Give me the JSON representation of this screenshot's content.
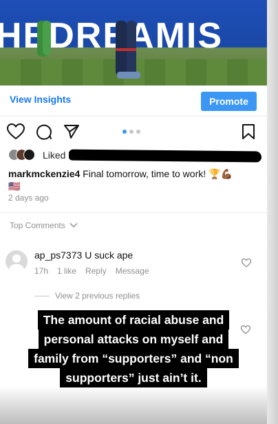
{
  "photo": {
    "board_text": "HEDREAMIS"
  },
  "actions": {
    "view_insights": "View Insights",
    "promote": "Promote"
  },
  "icons": [
    "heart-icon",
    "comment-icon",
    "send-icon",
    "bookmark-icon"
  ],
  "carousel": {
    "total": 3,
    "active": 1
  },
  "likes": {
    "prefix": "Liked b"
  },
  "caption": {
    "username": "markmckenzie4",
    "text": " Final tomorrow, time to work! 🏆💪🏾",
    "flag": "🇺🇸"
  },
  "time_ago": "2 days ago",
  "top_comments_label": "Top Comments",
  "comment": {
    "username": "ap_ps7373",
    "text": "U suck ape",
    "age": "17h",
    "likes": "1 like",
    "reply": "Reply",
    "message": "Message"
  },
  "view_replies": "View 2 previous replies",
  "overlay_lines": [
    "The amount of racial abuse and",
    "personal attacks on myself and",
    "family from “supporters” and “non",
    "supporters” just ain’t it."
  ],
  "colors": {
    "link_blue": "#1877f2",
    "button_blue": "#3b97f3",
    "meta_gray": "#8e8e8e"
  }
}
